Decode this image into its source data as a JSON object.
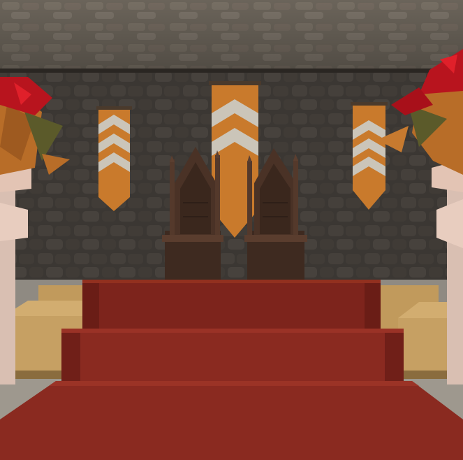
{
  "scene": {
    "description_visible_text": "",
    "colors": {
      "ceiling": "#6f675d",
      "wall": "#3a3632",
      "wall_mortar": "#28251f",
      "banner_orange": "#c97a2c",
      "banner_chevron": "#c9c4b8",
      "throne_wood": "#4a3226",
      "carpet_red": "#8a2a20",
      "carpet_dark": "#5a1a14",
      "gold_block": "#c6a063",
      "stone_floor": "#9a948a",
      "pillar_light": "#e8cdbf",
      "flower_red": "#b8141e",
      "leaf_orange": "#b86d28",
      "leaf_green": "#5b5a2a"
    },
    "objects": [
      {
        "name": "stone-ceiling"
      },
      {
        "name": "stone-wall"
      },
      {
        "name": "banner-left"
      },
      {
        "name": "banner-center"
      },
      {
        "name": "banner-right"
      },
      {
        "name": "throne-left"
      },
      {
        "name": "throne-right"
      },
      {
        "name": "red-carpet-dais"
      },
      {
        "name": "pillar-left"
      },
      {
        "name": "pillar-right"
      }
    ]
  }
}
